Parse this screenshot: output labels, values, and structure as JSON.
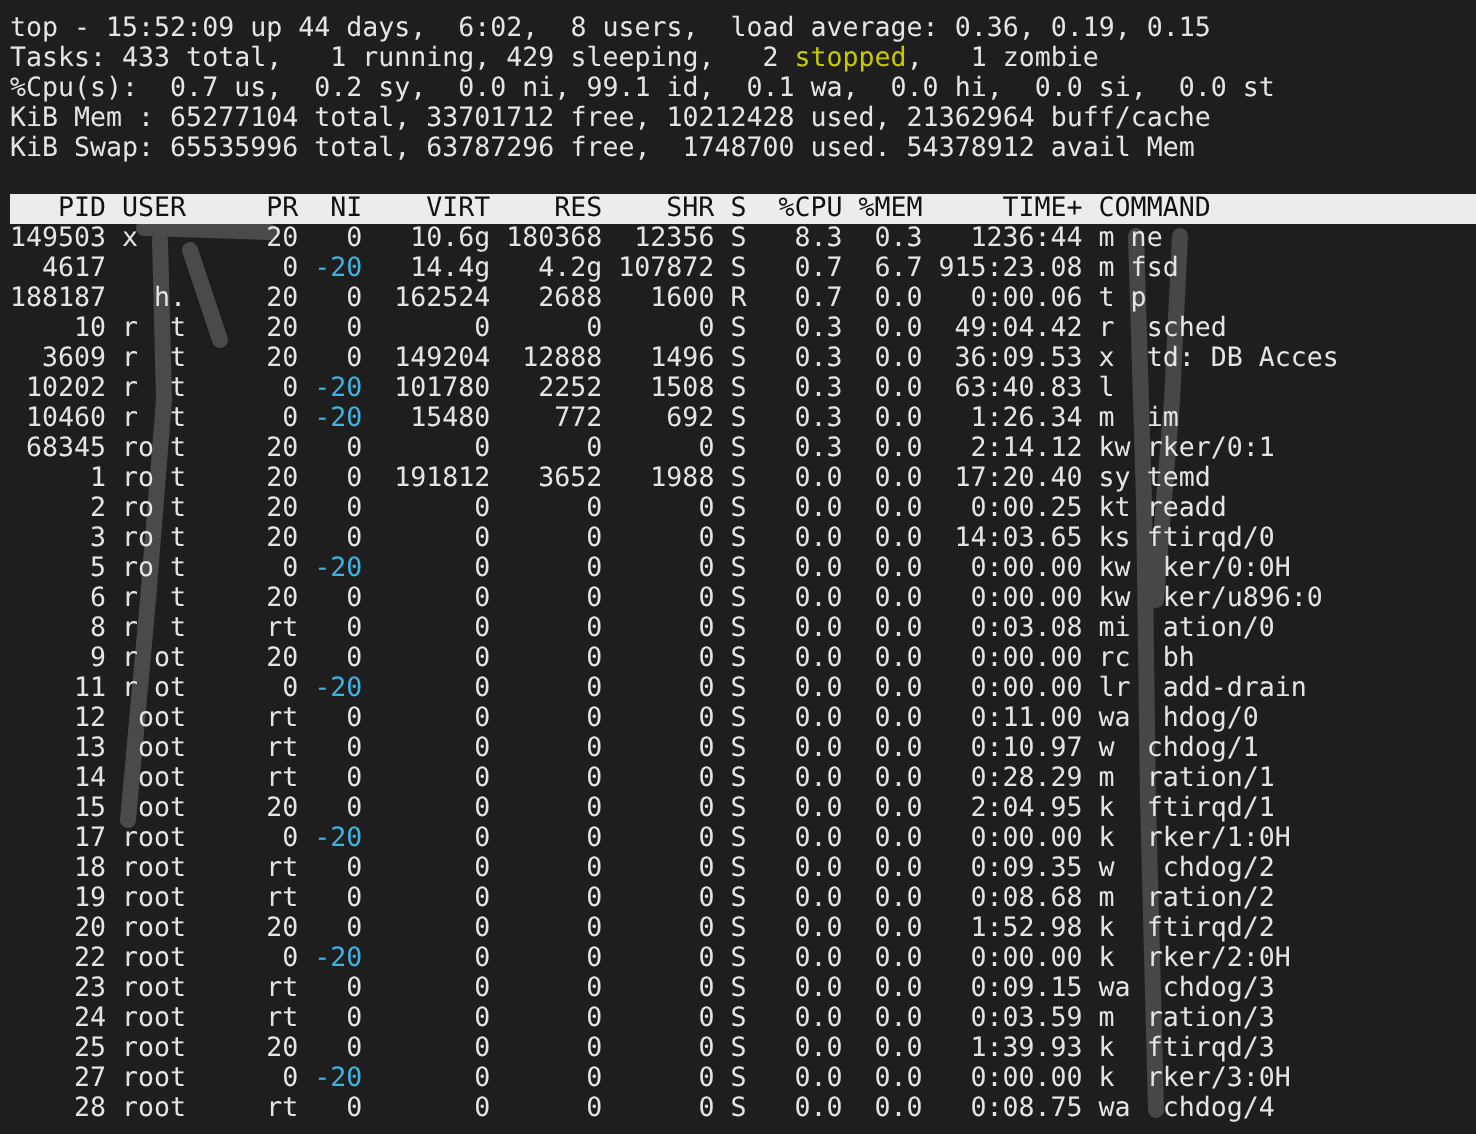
{
  "summary": [
    [
      {
        "text": "top - 15:52:09 up 44 days,  6:02,  8 users,  load average: 0.36, 0.19, 0.15",
        "highlight": false
      }
    ],
    [
      {
        "text": "Tasks: 433 total,   1 running, 429 sleeping,   2 ",
        "highlight": false
      },
      {
        "text": "stopped",
        "highlight": true
      },
      {
        "text": ",   1 zombie",
        "highlight": false
      }
    ],
    [
      {
        "text": "%Cpu(s):  0.7 us,  0.2 sy,  0.0 ni, 99.1 id,  0.1 wa,  0.0 hi,  0.0 si,  0.0 st",
        "highlight": false
      }
    ],
    [
      {
        "text": "KiB Mem : 65277104 total, 33701712 free, 10212428 used, 21362964 buff/cache",
        "highlight": false
      }
    ],
    [
      {
        "text": "KiB Swap: 65535996 total, 63787296 free,  1748700 used. 54378912 avail Mem",
        "highlight": false
      }
    ]
  ],
  "table": {
    "columns": [
      "PID",
      "USER",
      "PR",
      "NI",
      "VIRT",
      "RES",
      "SHR",
      "S",
      "%CPU",
      "%MEM",
      "TIME+",
      "COMMAND"
    ],
    "rows": [
      {
        "cells": [
          "149503",
          "x",
          "20",
          "0",
          "10.6g",
          "180368",
          "12356",
          "S",
          "8.3",
          "0.3",
          "1236:44",
          "m ne"
        ],
        "ni_highlight": false
      },
      {
        "cells": [
          "4617",
          "",
          "0",
          "-20",
          "14.4g",
          "4.2g",
          "107872",
          "S",
          "0.7",
          "6.7",
          "915:23.08",
          "m fsd"
        ],
        "ni_highlight": true
      },
      {
        "cells": [
          "188187",
          "  h.",
          "20",
          "0",
          "162524",
          "2688",
          "1600",
          "R",
          "0.7",
          "0.0",
          "0:00.06",
          "t p"
        ],
        "ni_highlight": false
      },
      {
        "cells": [
          "10",
          "r  t",
          "20",
          "0",
          "0",
          "0",
          "0",
          "S",
          "0.3",
          "0.0",
          "49:04.42",
          "r  sched"
        ],
        "ni_highlight": false
      },
      {
        "cells": [
          "3609",
          "r  t",
          "20",
          "0",
          "149204",
          "12888",
          "1496",
          "S",
          "0.3",
          "0.0",
          "36:09.53",
          "x  td: DB Acces"
        ],
        "ni_highlight": false
      },
      {
        "cells": [
          "10202",
          "r  t",
          "0",
          "-20",
          "101780",
          "2252",
          "1508",
          "S",
          "0.3",
          "0.0",
          "63:40.83",
          "l"
        ],
        "ni_highlight": true
      },
      {
        "cells": [
          "10460",
          "r  t",
          "0",
          "-20",
          "15480",
          "772",
          "692",
          "S",
          "0.3",
          "0.0",
          "1:26.34",
          "m  im"
        ],
        "ni_highlight": true
      },
      {
        "cells": [
          "68345",
          "ro t",
          "20",
          "0",
          "0",
          "0",
          "0",
          "S",
          "0.3",
          "0.0",
          "2:14.12",
          "kw rker/0:1"
        ],
        "ni_highlight": false
      },
      {
        "cells": [
          "1",
          "ro t",
          "20",
          "0",
          "191812",
          "3652",
          "1988",
          "S",
          "0.0",
          "0.0",
          "17:20.40",
          "sy temd"
        ],
        "ni_highlight": false
      },
      {
        "cells": [
          "2",
          "ro t",
          "20",
          "0",
          "0",
          "0",
          "0",
          "S",
          "0.0",
          "0.0",
          "0:00.25",
          "kt readd"
        ],
        "ni_highlight": false
      },
      {
        "cells": [
          "3",
          "ro t",
          "20",
          "0",
          "0",
          "0",
          "0",
          "S",
          "0.0",
          "0.0",
          "14:03.65",
          "ks ftirqd/0"
        ],
        "ni_highlight": false
      },
      {
        "cells": [
          "5",
          "ro t",
          "0",
          "-20",
          "0",
          "0",
          "0",
          "S",
          "0.0",
          "0.0",
          "0:00.00",
          "kw  ker/0:0H"
        ],
        "ni_highlight": true
      },
      {
        "cells": [
          "6",
          "r  t",
          "20",
          "0",
          "0",
          "0",
          "0",
          "S",
          "0.0",
          "0.0",
          "0:00.00",
          "kw  ker/u896:0"
        ],
        "ni_highlight": false
      },
      {
        "cells": [
          "8",
          "r  t",
          "rt",
          "0",
          "0",
          "0",
          "0",
          "S",
          "0.0",
          "0.0",
          "0:03.08",
          "mi  ation/0"
        ],
        "ni_highlight": false
      },
      {
        "cells": [
          "9",
          "r ot",
          "20",
          "0",
          "0",
          "0",
          "0",
          "S",
          "0.0",
          "0.0",
          "0:00.00",
          "rc  bh"
        ],
        "ni_highlight": false
      },
      {
        "cells": [
          "11",
          "r ot",
          "0",
          "-20",
          "0",
          "0",
          "0",
          "S",
          "0.0",
          "0.0",
          "0:00.00",
          "lr  add-drain"
        ],
        "ni_highlight": true
      },
      {
        "cells": [
          "12",
          " oot",
          "rt",
          "0",
          "0",
          "0",
          "0",
          "S",
          "0.0",
          "0.0",
          "0:11.00",
          "wa  hdog/0"
        ],
        "ni_highlight": false
      },
      {
        "cells": [
          "13",
          " oot",
          "rt",
          "0",
          "0",
          "0",
          "0",
          "S",
          "0.0",
          "0.0",
          "0:10.97",
          "w  chdog/1"
        ],
        "ni_highlight": false
      },
      {
        "cells": [
          "14",
          " oot",
          "rt",
          "0",
          "0",
          "0",
          "0",
          "S",
          "0.0",
          "0.0",
          "0:28.29",
          "m  ration/1"
        ],
        "ni_highlight": false
      },
      {
        "cells": [
          "15",
          " oot",
          "20",
          "0",
          "0",
          "0",
          "0",
          "S",
          "0.0",
          "0.0",
          "2:04.95",
          "k  ftirqd/1"
        ],
        "ni_highlight": false
      },
      {
        "cells": [
          "17",
          "root",
          "0",
          "-20",
          "0",
          "0",
          "0",
          "S",
          "0.0",
          "0.0",
          "0:00.00",
          "k  rker/1:0H"
        ],
        "ni_highlight": true
      },
      {
        "cells": [
          "18",
          "root",
          "rt",
          "0",
          "0",
          "0",
          "0",
          "S",
          "0.0",
          "0.0",
          "0:09.35",
          "w   chdog/2"
        ],
        "ni_highlight": false
      },
      {
        "cells": [
          "19",
          "root",
          "rt",
          "0",
          "0",
          "0",
          "0",
          "S",
          "0.0",
          "0.0",
          "0:08.68",
          "m  ration/2"
        ],
        "ni_highlight": false
      },
      {
        "cells": [
          "20",
          "root",
          "20",
          "0",
          "0",
          "0",
          "0",
          "S",
          "0.0",
          "0.0",
          "1:52.98",
          "k  ftirqd/2"
        ],
        "ni_highlight": false
      },
      {
        "cells": [
          "22",
          "root",
          "0",
          "-20",
          "0",
          "0",
          "0",
          "S",
          "0.0",
          "0.0",
          "0:00.00",
          "k  rker/2:0H"
        ],
        "ni_highlight": true
      },
      {
        "cells": [
          "23",
          "root",
          "rt",
          "0",
          "0",
          "0",
          "0",
          "S",
          "0.0",
          "0.0",
          "0:09.15",
          "wa  chdog/3"
        ],
        "ni_highlight": false
      },
      {
        "cells": [
          "24",
          "root",
          "rt",
          "0",
          "0",
          "0",
          "0",
          "S",
          "0.0",
          "0.0",
          "0:03.59",
          "m  ration/3"
        ],
        "ni_highlight": false
      },
      {
        "cells": [
          "25",
          "root",
          "20",
          "0",
          "0",
          "0",
          "0",
          "S",
          "0.0",
          "0.0",
          "1:39.93",
          "k  ftirqd/3"
        ],
        "ni_highlight": false
      },
      {
        "cells": [
          "27",
          "root",
          "0",
          "-20",
          "0",
          "0",
          "0",
          "S",
          "0.0",
          "0.0",
          "0:00.00",
          "k  rker/3:0H"
        ],
        "ni_highlight": true
      },
      {
        "cells": [
          "28",
          "root",
          "rt",
          "0",
          "0",
          "0",
          "0",
          "S",
          "0.0",
          "0.0",
          "0:08.75",
          "wa  chdog/4"
        ],
        "ni_highlight": false
      }
    ]
  }
}
